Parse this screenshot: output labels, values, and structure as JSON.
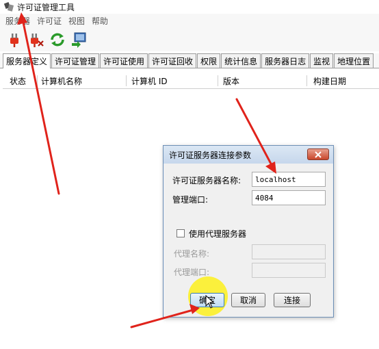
{
  "window": {
    "title": "许可证管理工具"
  },
  "menu": {
    "items": [
      "服务器",
      "许可证",
      "视图",
      "帮助"
    ]
  },
  "toolbar": {
    "buttons": [
      "plug-connect-icon",
      "plug-disconnect-icon",
      "refresh-icon",
      "monitor-export-icon"
    ]
  },
  "tabs": {
    "items": [
      "服务器定义",
      "许可证管理",
      "许可证使用",
      "许可证回收",
      "权限",
      "统计信息",
      "服务器日志",
      "监视",
      "地理位置"
    ],
    "active_index": 0
  },
  "table": {
    "columns": [
      "状态",
      "计算机名称",
      "计算机 ID",
      "版本",
      "构建日期"
    ]
  },
  "dialog": {
    "title": "许可证服务器连接参数",
    "server_name_label": "许可证服务器名称:",
    "server_name_value": "localhost",
    "port_label": "管理端口:",
    "port_value": "4084",
    "use_proxy_label": "使用代理服务器",
    "use_proxy_checked": false,
    "proxy_name_label": "代理名称:",
    "proxy_name_value": "",
    "proxy_port_label": "代理端口:",
    "proxy_port_value": "",
    "ok_label": "确定",
    "cancel_label": "取消",
    "connect_label": "连接"
  },
  "colors": {
    "annotation_arrow": "#e0231b",
    "highlight": "#fff000",
    "dialog_border": "#6d8fb5",
    "close_button": "#c9462b"
  }
}
